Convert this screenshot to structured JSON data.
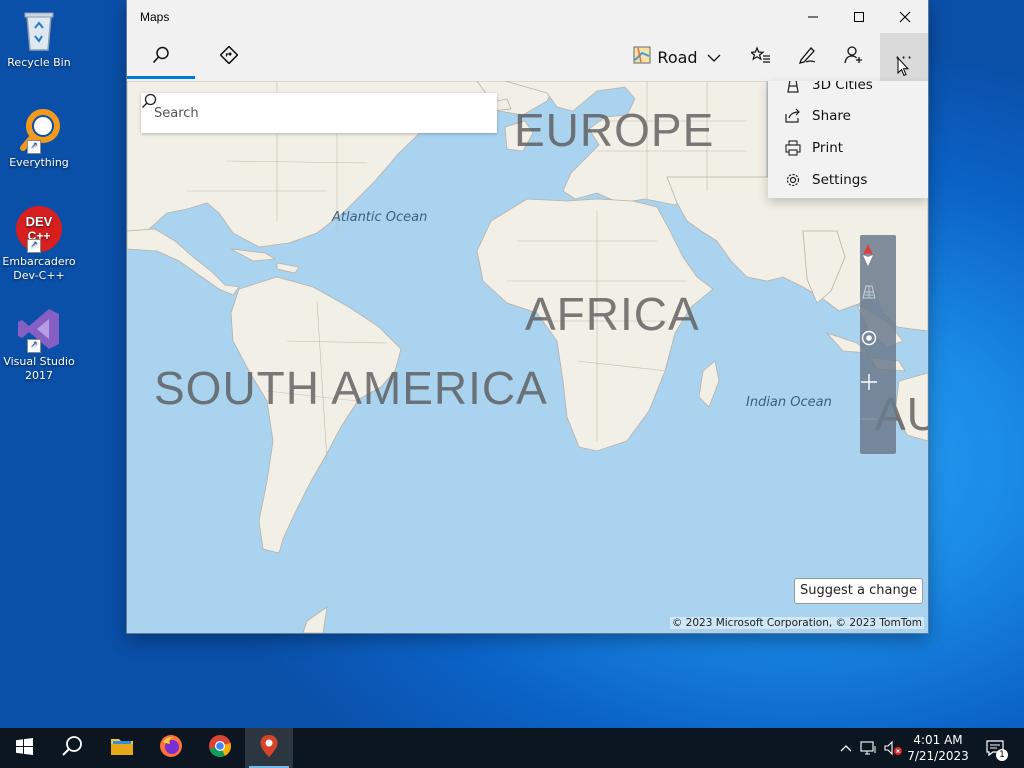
{
  "desktop": {
    "icons": [
      {
        "label": "Recycle Bin"
      },
      {
        "label": "Everything"
      },
      {
        "label": "Embarcadero Dev-C++",
        "badge": "DEV C++"
      },
      {
        "label": "Visual Studio 2017"
      }
    ]
  },
  "window": {
    "title": "Maps",
    "controls": {
      "minimize": "—",
      "maximize": "☐",
      "close": "✕"
    },
    "toolbar": {
      "search_icon": "search-icon",
      "directions_icon": "directions-icon",
      "map_view_label": "Road",
      "favorites_icon": "favorites-icon",
      "ink_icon": "ink-pen-icon",
      "account_icon": "account-icon",
      "more_label": "···"
    },
    "search": {
      "placeholder": "Search"
    },
    "menu": {
      "items": [
        {
          "label": "3D Cities",
          "icon": "3d-cities-icon"
        },
        {
          "label": "Share",
          "icon": "share-icon"
        },
        {
          "label": "Print",
          "icon": "print-icon"
        },
        {
          "label": "Settings",
          "icon": "gear-icon"
        }
      ]
    },
    "map": {
      "regions": [
        "EUROPE",
        "AFRICA",
        "SOUTH AMERICA",
        "AU"
      ],
      "oceans": [
        "Atlantic Ocean",
        "Indian Ocean"
      ],
      "suggest_label": "Suggest a change",
      "copyright": "© 2023 Microsoft Corporation, © 2023 TomTom",
      "colors": {
        "water": "#aad3f0",
        "land": "#f2efe6",
        "border": "#b9b1a6"
      }
    }
  },
  "taskbar": {
    "apps": [
      {
        "name": "start",
        "icon": "windows-logo-icon"
      },
      {
        "name": "search",
        "icon": "search-icon"
      },
      {
        "name": "file-explorer",
        "icon": "folder-icon"
      },
      {
        "name": "firefox",
        "icon": "firefox-icon"
      },
      {
        "name": "chrome",
        "icon": "chrome-icon"
      },
      {
        "name": "maps",
        "icon": "maps-icon"
      }
    ],
    "clock": {
      "time": "4:01 AM",
      "date": "7/21/2023"
    },
    "notification_count": "1"
  }
}
